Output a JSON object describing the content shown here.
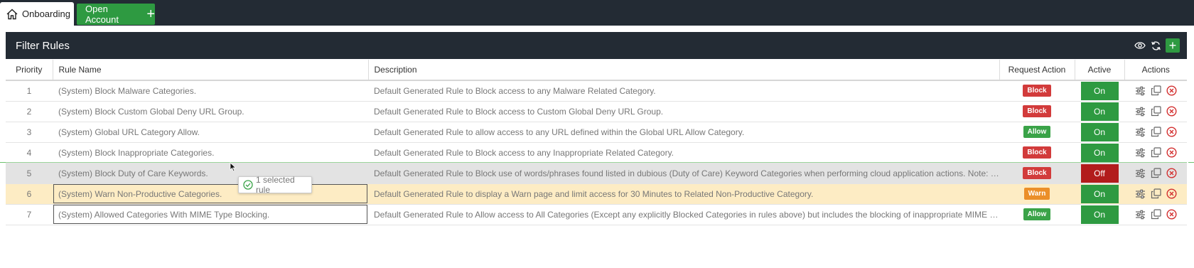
{
  "tabs": {
    "home_label": "Onboarding",
    "open_account_label": "Open Account"
  },
  "panel": {
    "title": "Filter Rules"
  },
  "columns": {
    "priority": "Priority",
    "rule_name": "Rule Name",
    "description": "Description",
    "request_action": "Request Action",
    "active": "Active",
    "actions": "Actions"
  },
  "rows": [
    {
      "priority": "1",
      "name": "(System) Block Malware Categories.",
      "description": "Default Generated Rule to Block access to any Malware Related Category.",
      "action": "Block",
      "active": "On"
    },
    {
      "priority": "2",
      "name": "(System) Block Custom Global Deny URL Group.",
      "description": "Default Generated Rule to Block access to Custom Global Deny URL Group.",
      "action": "Block",
      "active": "On"
    },
    {
      "priority": "3",
      "name": "(System) Global URL Category Allow.",
      "description": "Default Generated Rule to allow access to any URL defined within the Global URL Allow Category.",
      "action": "Allow",
      "active": "On"
    },
    {
      "priority": "4",
      "name": "(System) Block Inappropriate Categories.",
      "description": "Default Generated Rule to Block access to any Inappropriate Related Category.",
      "action": "Block",
      "active": "On"
    },
    {
      "priority": "5",
      "name": "(System) Block Duty of Care Keywords.",
      "description": "Default Generated Rule to Block use of words/phrases found listed in dubious (Duty of Care) Keyword Categories when performing cloud application actions. Note: Req...",
      "action": "Block",
      "active": "Off"
    },
    {
      "priority": "6",
      "name": "(System) Warn Non-Productive Categories.",
      "description": "Default Generated Rule to display a Warn page and limit access for 30 Minutes to Related Non-Productive Category.",
      "action": "Warn",
      "active": "On"
    },
    {
      "priority": "7",
      "name": "(System) Allowed Categories With MIME Type Blocking.",
      "description": "Default Generated Rule to Allow access to All Categories (Except any explicitly Blocked Categories in rules above) but includes the blocking of inappropriate MIME types...",
      "action": "Allow",
      "active": "On"
    }
  ],
  "drag_tooltip": "1 selected rule",
  "colors": {
    "block": "#d23b3b",
    "allow": "#3aa348",
    "warn": "#eb8f2a",
    "on": "#2e9a41",
    "off": "#b21c1c",
    "header_bg": "#232b34"
  },
  "icons": [
    "home-icon",
    "plus-icon",
    "eye-icon",
    "refresh-icon",
    "sliders-icon",
    "copy-icon",
    "delete-icon",
    "check-circle-icon",
    "cursor-icon"
  ]
}
